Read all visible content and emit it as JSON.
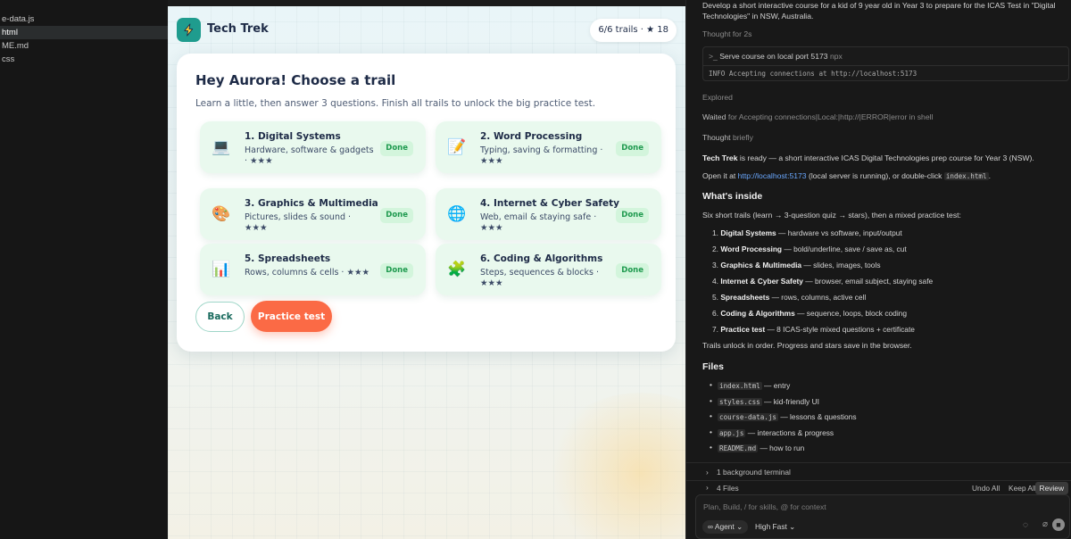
{
  "explorer": {
    "files": [
      "e-data.js",
      "html",
      "ME.md",
      "css"
    ],
    "active_index": 1
  },
  "app": {
    "brand": "Tech Trek",
    "stat": "6/6 trails · ★ 18",
    "card_title": "Hey Aurora! Choose a trail",
    "card_subtitle": "Learn a little, then answer 3 questions. Finish all trails to unlock the big practice test.",
    "trails": [
      {
        "icon": "💻",
        "icon_name": "laptop-icon",
        "title": "1. Digital Systems",
        "desc": "Hardware, software & gadgets · ★★★",
        "status": "Done"
      },
      {
        "icon": "📝",
        "icon_name": "memo-icon",
        "title": "2. Word Processing",
        "desc": "Typing, saving & formatting · ★★★",
        "status": "Done"
      },
      {
        "icon": "🎨",
        "icon_name": "palette-icon",
        "title": "3. Graphics & Multimedia",
        "desc": "Pictures, slides & sound · ★★★",
        "status": "Done"
      },
      {
        "icon": "🌐",
        "icon_name": "globe-icon",
        "title": "4. Internet & Cyber Safety",
        "desc": "Web, email & staying safe · ★★★",
        "status": "Done"
      },
      {
        "icon": "📊",
        "icon_name": "bar-chart-icon",
        "title": "5. Spreadsheets",
        "desc": "Rows, columns & cells · ★★★",
        "status": "Done"
      },
      {
        "icon": "🧩",
        "icon_name": "puzzle-icon",
        "title": "6. Coding & Algorithms",
        "desc": "Steps, sequences & blocks · ★★★",
        "status": "Done"
      }
    ],
    "back_label": "Back",
    "practice_label": "Practice test",
    "colors": {
      "accent": "#1f9c8e",
      "primary_button": "#fb6a45",
      "done": "#1f9a4f"
    }
  },
  "chat": {
    "prompt_line1": "Develop a short interactive course for a kid of 9 year old in Year 3 to prepare for the ICAS Test in \"Digital",
    "prompt_line2": "Technologies\" in NSW, Australia.",
    "thought1": "Thought for 2s",
    "terminal_cmd": "Serve course on local port 5173",
    "terminal_suffix": "npx",
    "terminal_output": "INFO  Accepting connections at http://localhost:5173",
    "explored": "Explored",
    "waited_label": "Waited",
    "waited_detail": "for Accepting connections|Local:|http://|ERROR|error in shell",
    "thought2_label": "Thought",
    "thought2_detail": "briefly",
    "ready_name": "Tech Trek",
    "ready_text": " is ready — a short interactive ICAS Digital Technologies prep course for Year 3 (NSW).",
    "open_prefix": "Open it at ",
    "open_link": "http://localhost:5173",
    "open_mid": " (local server is running), or double-click ",
    "open_code": "index.html",
    "open_suffix": ".",
    "whats_inside": "What's inside",
    "inside_intro": "Six short trails (learn → 3-question quiz → stars), then a mixed practice test:",
    "inside_items": [
      {
        "num": "1.",
        "name": "Digital Systems",
        "rest": " — hardware vs software, input/output"
      },
      {
        "num": "2.",
        "name": "Word Processing",
        "rest": " — bold/underline, save / save as, cut"
      },
      {
        "num": "3.",
        "name": "Graphics & Multimedia",
        "rest": " — slides, images, tools"
      },
      {
        "num": "4.",
        "name": "Internet & Cyber Safety",
        "rest": " — browser, email subject, staying safe"
      },
      {
        "num": "5.",
        "name": "Spreadsheets",
        "rest": " — rows, columns, active cell"
      },
      {
        "num": "6.",
        "name": "Coding & Algorithms",
        "rest": " — sequence, loops, block coding"
      },
      {
        "num": "7.",
        "name": "Practice test",
        "rest": " — 8 ICAS-style mixed questions + certificate"
      }
    ],
    "unlock_note": "Trails unlock in order. Progress and stars save in the browser.",
    "files_heading": "Files",
    "files": [
      {
        "name": "index.html",
        "desc": " — entry"
      },
      {
        "name": "styles.css",
        "desc": " — kid-friendly UI"
      },
      {
        "name": "course-data.js",
        "desc": " — lessons & questions"
      },
      {
        "name": "app.js",
        "desc": " — interactions & progress"
      },
      {
        "name": "README.md",
        "desc": " — how to run"
      }
    ],
    "bg_terminal": "1 background terminal",
    "files_changed": "4 Files",
    "undo_all": "Undo All",
    "keep_all": "Keep All",
    "review": "Review",
    "composer_placeholder": "Plan, Build, / for skills, @ for context",
    "agent_label": "Agent",
    "model_label": "High Fast"
  }
}
